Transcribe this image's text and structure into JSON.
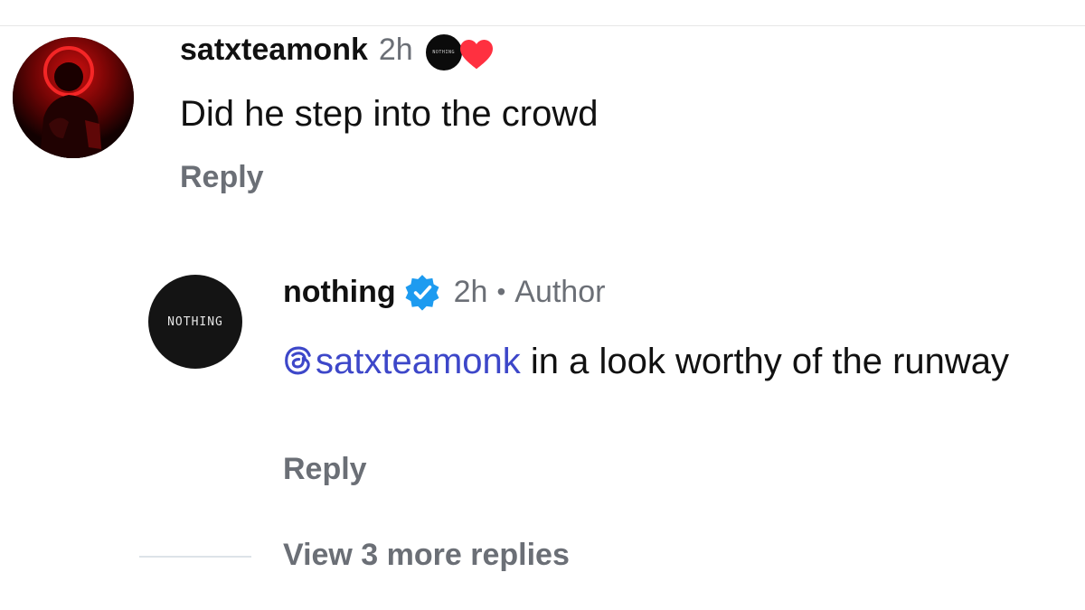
{
  "comments": [
    {
      "username": "satxteamonk",
      "time": "2h",
      "text": "Did he step into the crowd",
      "reply_label": "Reply",
      "liked_by_author_badge": "NOTHING"
    },
    {
      "username": "nothing",
      "verified": true,
      "time": "2h",
      "separator": "•",
      "author_label": "Author",
      "mention": "satxteamonk",
      "text": " in a look worthy of the runway",
      "reply_label": "Reply",
      "avatar_text": "NOTHING"
    }
  ],
  "view_more": "View 3 more replies",
  "colors": {
    "text": "#111111",
    "muted": "#6b6f76",
    "mention": "#3d47c9",
    "verified": "#1d9bf0",
    "heart": "#ff3040"
  }
}
